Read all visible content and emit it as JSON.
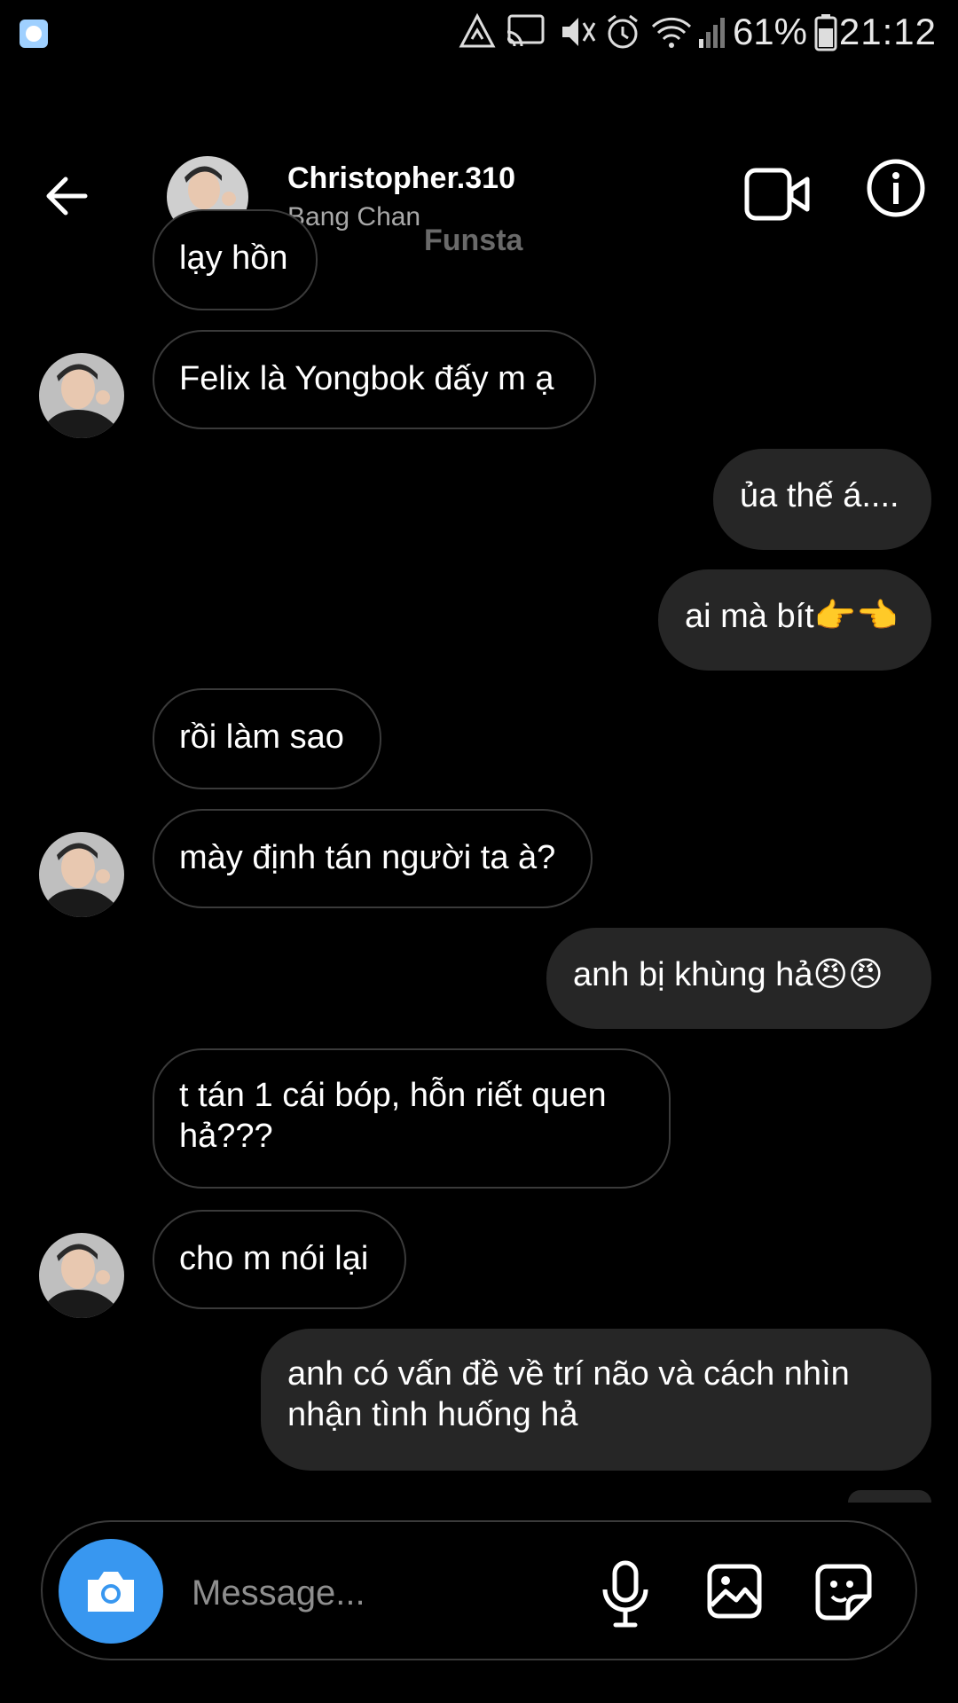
{
  "status_bar": {
    "battery_percent": "61%",
    "time": "21:12",
    "icons": [
      "app-notification-icon",
      "recycle-icon",
      "cast-icon",
      "vibrate-mute-icon",
      "alarm-icon",
      "wifi-icon",
      "signal-icon",
      "battery-icon"
    ]
  },
  "header": {
    "username": "Christopher.310",
    "display_name": "Bang Chan",
    "watermark": "Funsta",
    "icons": [
      "back-arrow-icon",
      "video-call-icon",
      "info-icon"
    ]
  },
  "messages": [
    {
      "side": "received",
      "text": "lạy hồn"
    },
    {
      "side": "received",
      "text": "Felix là Yongbok đấy m ạ"
    },
    {
      "side": "sent",
      "text": "ủa thế á...."
    },
    {
      "side": "sent",
      "text": "ai mà bít👉👈"
    },
    {
      "side": "received",
      "text": "rồi làm sao"
    },
    {
      "side": "received",
      "text": "mày định tán người ta à?"
    },
    {
      "side": "sent",
      "text": "anh bị khùng hả😠😠"
    },
    {
      "side": "received",
      "text": "t tán 1 cái bóp, hỗn riết quen hả???"
    },
    {
      "side": "received",
      "text": "cho m nói lại"
    },
    {
      "side": "sent",
      "text": "anh có vấn đề về trí não và cách nhìn nhận tình huống hả"
    }
  ],
  "composer": {
    "placeholder": "Message...",
    "icons": [
      "camera-icon",
      "microphone-icon",
      "gallery-icon",
      "sticker-icon"
    ]
  },
  "colors": {
    "background": "#000000",
    "sent_bubble": "#262626",
    "received_border": "#3a3a3a",
    "camera_button": "#3897f0",
    "secondary_text": "#a8a8a8"
  }
}
